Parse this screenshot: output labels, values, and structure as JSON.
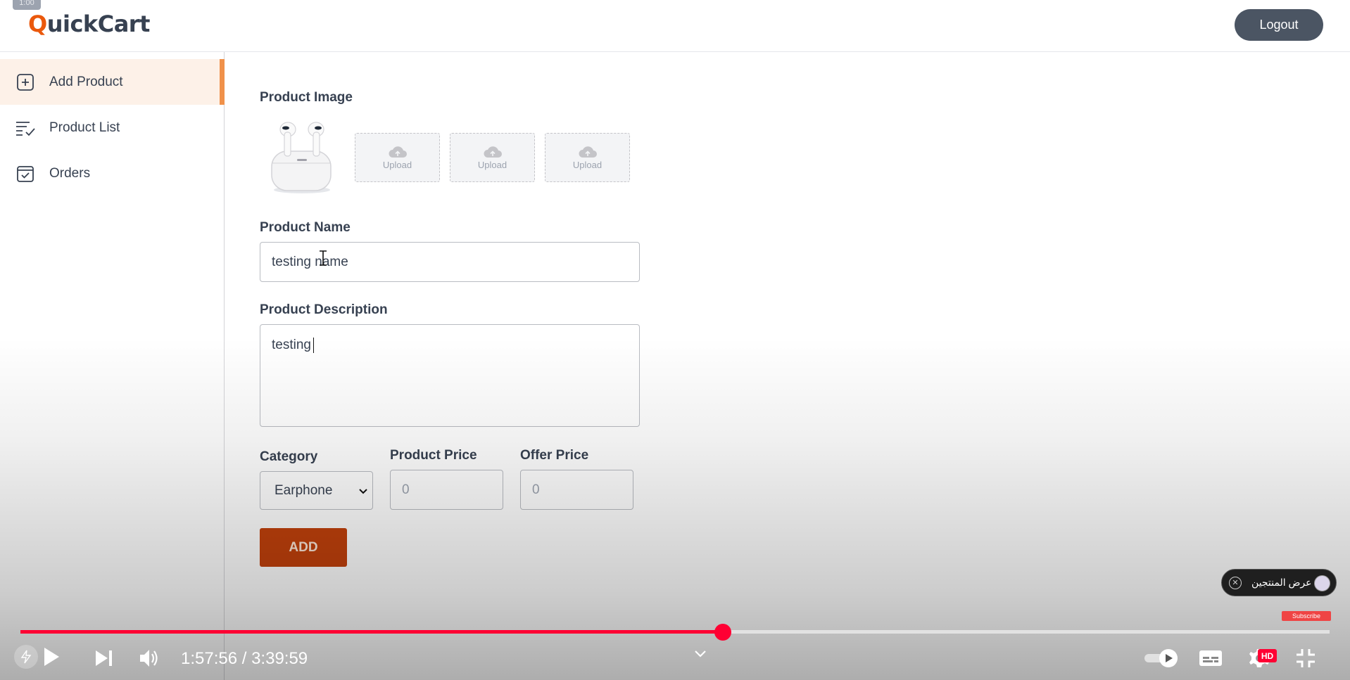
{
  "app": {
    "logo_first": "Q",
    "logo_rest": "uickCart",
    "logout_label": "Logout",
    "top_pill": "1:00"
  },
  "sidebar": {
    "items": [
      {
        "label": "Add Product",
        "icon": "add-square-icon",
        "active": true
      },
      {
        "label": "Product List",
        "icon": "list-check-icon",
        "active": false
      },
      {
        "label": "Orders",
        "icon": "calendar-check-icon",
        "active": false
      }
    ]
  },
  "form": {
    "product_image_label": "Product Image",
    "upload_label": "Upload",
    "product_name_label": "Product Name",
    "product_name_value": "testing name",
    "product_description_label": "Product Description",
    "product_description_value": "testing",
    "category_label": "Category",
    "category_value": "Earphone",
    "product_price_label": "Product Price",
    "product_price_placeholder": "0",
    "offer_price_label": "Offer Price",
    "offer_price_placeholder": "0",
    "add_label": "ADD"
  },
  "player": {
    "current_time": "1:57:56",
    "total_time": "3:39:59",
    "time_display": "1:57:56 / 3:39:59",
    "progress_fraction": 0.5364,
    "featured_label": "عرض المنتجين",
    "subscribe_label": "Subscribe",
    "hd_label": "HD",
    "accent_color": "#ff0033"
  },
  "colors": {
    "brand_accent": "#ea580c",
    "add_button": "#c2410c",
    "logout_button": "#4b5563",
    "sidebar_active_bg": "#fdf1e8",
    "sidebar_active_border": "#f0914a"
  }
}
